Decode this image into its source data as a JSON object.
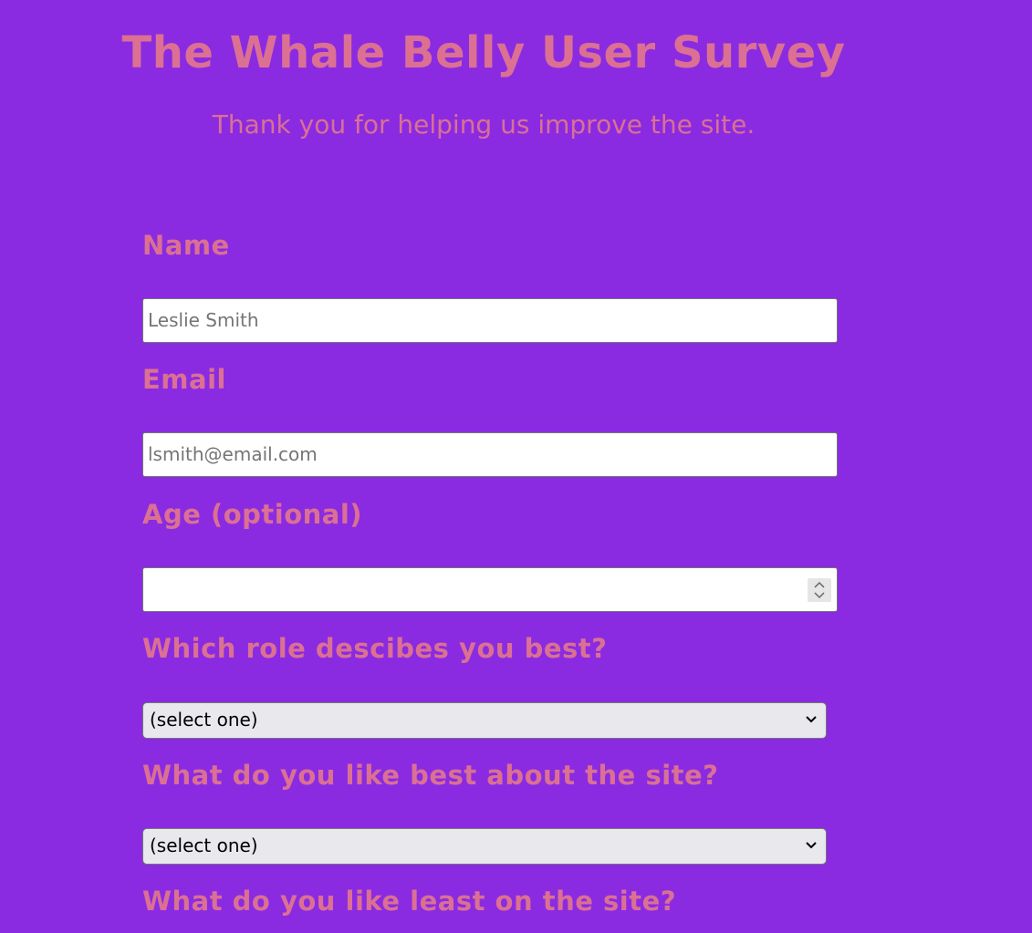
{
  "header": {
    "title": "The Whale Belly User Survey",
    "subtitle": "Thank you for helping us improve the site."
  },
  "form": {
    "name": {
      "label": "Name",
      "placeholder": "Leslie Smith",
      "value": ""
    },
    "email": {
      "label": "Email",
      "placeholder": "lsmith@email.com",
      "value": ""
    },
    "age": {
      "label": "Age (optional)",
      "value": ""
    },
    "role": {
      "label": "Which role descibes you best?",
      "selected": "(select one)"
    },
    "like_best": {
      "label": "What do you like best about the site?",
      "selected": "(select one)"
    },
    "like_least": {
      "label": "What do you like least on the site?"
    }
  },
  "colors": {
    "background": "#8a2be2",
    "text": "#db7093",
    "input_bg": "#ffffff",
    "select_bg": "#e9e8ed"
  },
  "icons": {
    "spinner": "up-down-arrows-icon",
    "dropdown": "chevron-down-icon"
  }
}
